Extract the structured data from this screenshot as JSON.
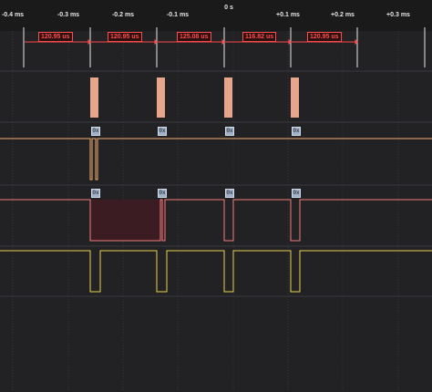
{
  "timeline": {
    "zero_label": "0 s",
    "ticks": [
      "-0.4 ms",
      "-0.3 ms",
      "-0.2 ms",
      "-0.1 ms",
      "+0.1 ms",
      "+0.2 ms",
      "+0.3 ms"
    ]
  },
  "measurements": [
    "120.95 us",
    "120.95 us",
    "125.08 us",
    "116.82 us",
    "120.95 us"
  ],
  "packet_tags": {
    "channel_a": [
      "0x",
      "0x",
      "0x",
      "0x"
    ],
    "channel_b": [
      "0x",
      "0x",
      "0x",
      "0x"
    ]
  },
  "colors": {
    "background": "#222224",
    "timeline_bg": "#1a1a1b",
    "measurement": "#ff4b4b",
    "marker": "#e8e8e8",
    "pulse_fill": "#e7a58c",
    "trace_orange": "#f0b070",
    "trace_red": "#f27d7d",
    "trace_yellow": "#e8d24f"
  }
}
